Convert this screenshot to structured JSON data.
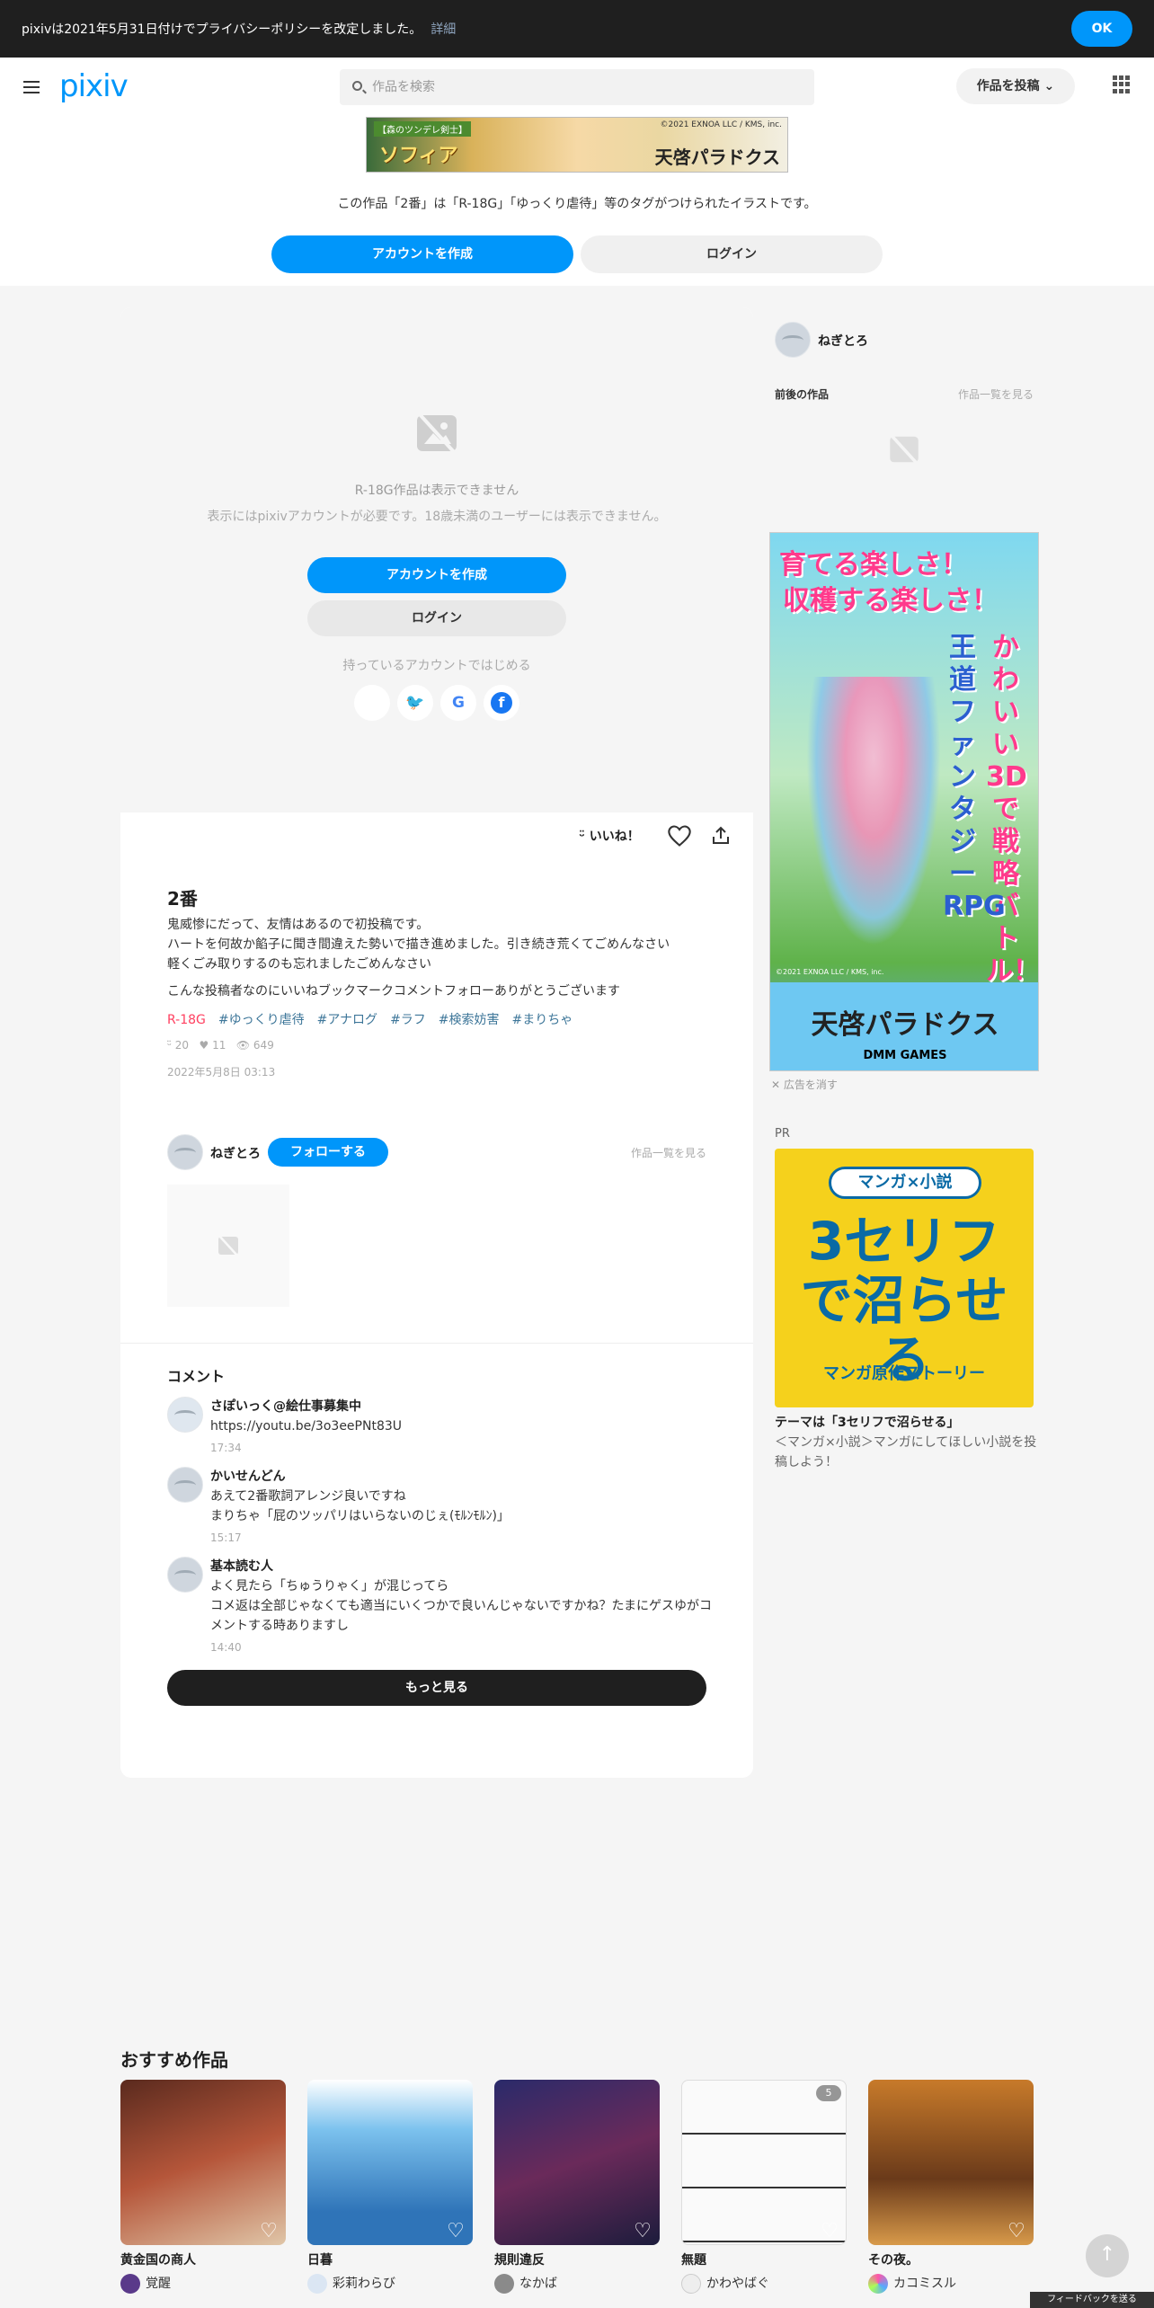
{
  "notice": {
    "text": "pixivは2021年5月31日付けでプライバシーポリシーを改定しました。",
    "more": "詳細",
    "ok": "OK"
  },
  "header": {
    "logo": "pixiv",
    "search_placeholder": "作品を検索",
    "post_button": "作品を投稿",
    "banner": {
      "badge": "【森のツンデレ剣士】",
      "name": "ソフィア",
      "copyright": "©2021 EXNOA LLC / KMS, inc.",
      "game": "天啓パラドクス"
    },
    "tagline": "この作品「2番」は「R-18G」「ゆっくり虐待」等のタグがつけられたイラストです。",
    "create_account": "アカウントを作成",
    "login": "ログイン"
  },
  "locked": {
    "title": "R-18G作品は表示できません",
    "subtitle": "表示にはpixivアカウントが必要です。18歳未満のユーザーには表示できません。",
    "create_account": "アカウントを作成",
    "login": "ログイン",
    "existing": "持っているアカウントではじめる"
  },
  "actions": {
    "like": "いいね！"
  },
  "artwork": {
    "title": "2番",
    "desc1": "鬼威惨にだって、友情はあるので初投稿です。",
    "desc2": "ハートを何故か餡子に聞き間違えた勢いで描き進めました。引き続き荒くてごめんなさい",
    "desc3": "軽くごみ取りするのも忘れましたごめんなさい",
    "desc4": "こんな投稿者なのにいいねブックマークコメントフォローありがとうございます",
    "tags": [
      "R-18G",
      "#ゆっくり虐待",
      "#アナログ",
      "#ラフ",
      "#検索妨害",
      "#まりちゃ"
    ],
    "likes": "20",
    "bookmarks": "11",
    "views": "649",
    "date": "2022年5月8日 03:13"
  },
  "author": {
    "name": "ねぎとろ",
    "follow": "フォローする",
    "see_all": "作品一覧を見る"
  },
  "comments": {
    "heading": "コメント",
    "items": [
      {
        "name": "さぽいっく@絵仕事募集中",
        "body": "https://youtu.be/3o3eePNt83U",
        "time": "17:34"
      },
      {
        "name": "かいせんどん",
        "body": "あえて2番歌詞アレンジ良いですね\nまりちゃ「屁のツッパリはいらないのじぇ(ﾓﾙﾝﾓﾙﾝ)」",
        "time": "15:17"
      },
      {
        "name": "基本読む人",
        "body": "よく見たら「ちゅうりゃく」が混じってら\nコメ返は全部じゃなくても適当にいくつかで良いんじゃないですかね？たまにゲスゆがコメントする時ありますし",
        "time": "14:40"
      }
    ],
    "more": "もっと見る"
  },
  "sidebar": {
    "user": "ねぎとろ",
    "prev_next": "前後の作品",
    "see_all": "作品一覧を見る",
    "ad": {
      "line1": "育てる楽しさ！",
      "line2": "収穫する楽しさ！",
      "line3": "かわいい3Dで戦略バトル！",
      "line4": "王道ファンタジーRPG",
      "copyright": "©2021 EXNOA LLC / KMS, inc.",
      "logo": "天啓パラドクス",
      "dmm": "DMM GAMES"
    },
    "hide_ad": "広告を消す",
    "pr_label": "PR",
    "pr": {
      "badge": "マンガ×小説",
      "big": "3セリフで沼らせる",
      "sub": "マンガ原作ストーリー",
      "title": "テーマは「3セリフで沼らせる」",
      "desc": "＜マンガ×小説＞マンガにしてほしい小説を投稿しよう！"
    }
  },
  "recommended": {
    "heading": "おすすめ作品",
    "items": [
      {
        "title": "黄金国の商人",
        "user": "覚醒",
        "color": "#8a3a22"
      },
      {
        "title": "日暮",
        "user": "彩莉わらび",
        "color": "#3a8fd0"
      },
      {
        "title": "規則違反",
        "user": "なかば",
        "color": "#3a2f6a"
      },
      {
        "title": "無題",
        "user": "かわやばぐ",
        "color": "#e8e8e8"
      },
      {
        "title": "その夜。",
        "user": "カコミスル",
        "color": "#c77a2a"
      }
    ],
    "count_badge": "5"
  },
  "footer": {
    "feedback": "フィードバックを送る"
  },
  "colors": {
    "accent": "#0096fa",
    "dark": "#1f1f1f",
    "r18": "#ff4060"
  }
}
